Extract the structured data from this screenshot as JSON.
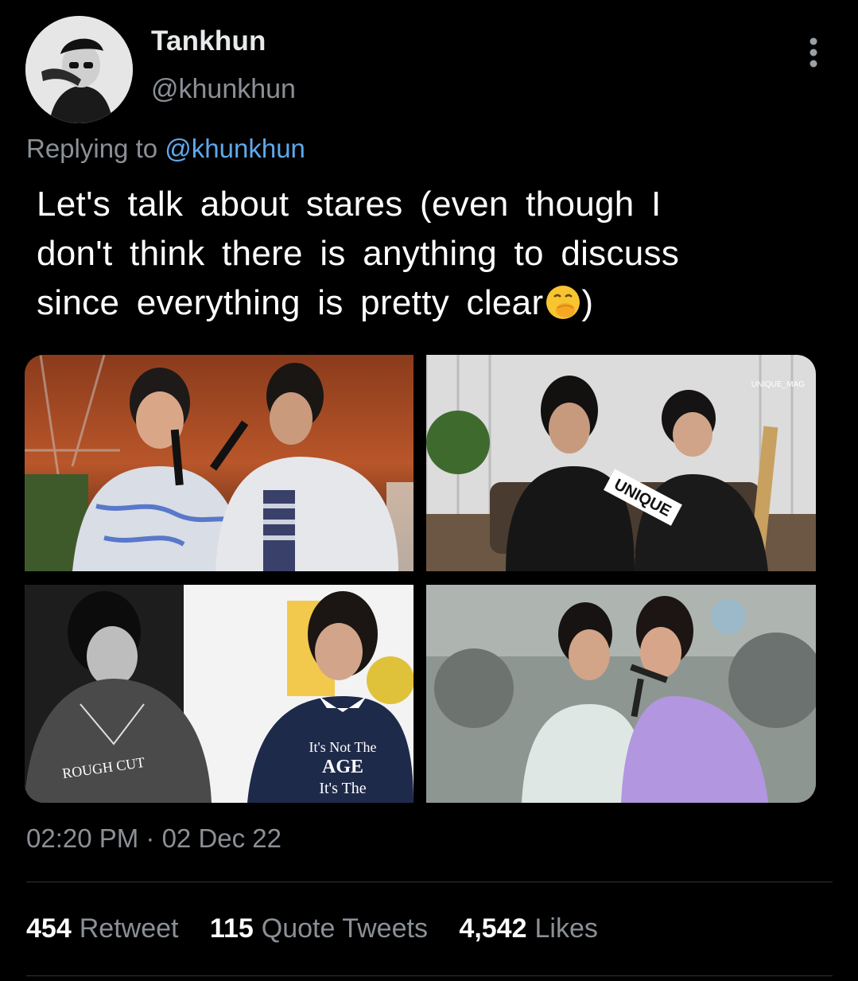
{
  "author": {
    "display_name": "Tankhun",
    "handle": "@khunkhun",
    "avatar_icon": "profile-photo-icon"
  },
  "menu": {
    "icon": "more-vertical-icon"
  },
  "reply": {
    "prefix": "Replying to",
    "target": "@khunkhun"
  },
  "tweet": {
    "lines": [
      "Let's talk about stares (even though I",
      "don't think there is anything to discuss",
      "since everything is pretty clear"
    ],
    "emoji_icon": "face-with-hand-over-mouth-emoji",
    "suffix": ")"
  },
  "media": {
    "photo2_badge": "UNIQUE",
    "photo2_watermark": "UNIQUE_MAG",
    "photo3_hoodie": "ROUGH CUT",
    "photo3_shirt_line1": "It's Not The",
    "photo3_shirt_line2": "AGE",
    "photo3_shirt_line3": "It's The"
  },
  "meta": {
    "timestamp": "02:20 PM · 02 Dec 22"
  },
  "stats": {
    "retweets_count": "454",
    "retweets_label": "Retweet",
    "quotes_count": "115",
    "quotes_label": "Quote Tweets",
    "likes_count": "4,542",
    "likes_label": "Likes"
  },
  "colors": {
    "background": "#000000",
    "text_primary": "#ffffff",
    "text_secondary": "#8b9096",
    "link": "#5fa8ea",
    "divider": "#2f3336"
  }
}
